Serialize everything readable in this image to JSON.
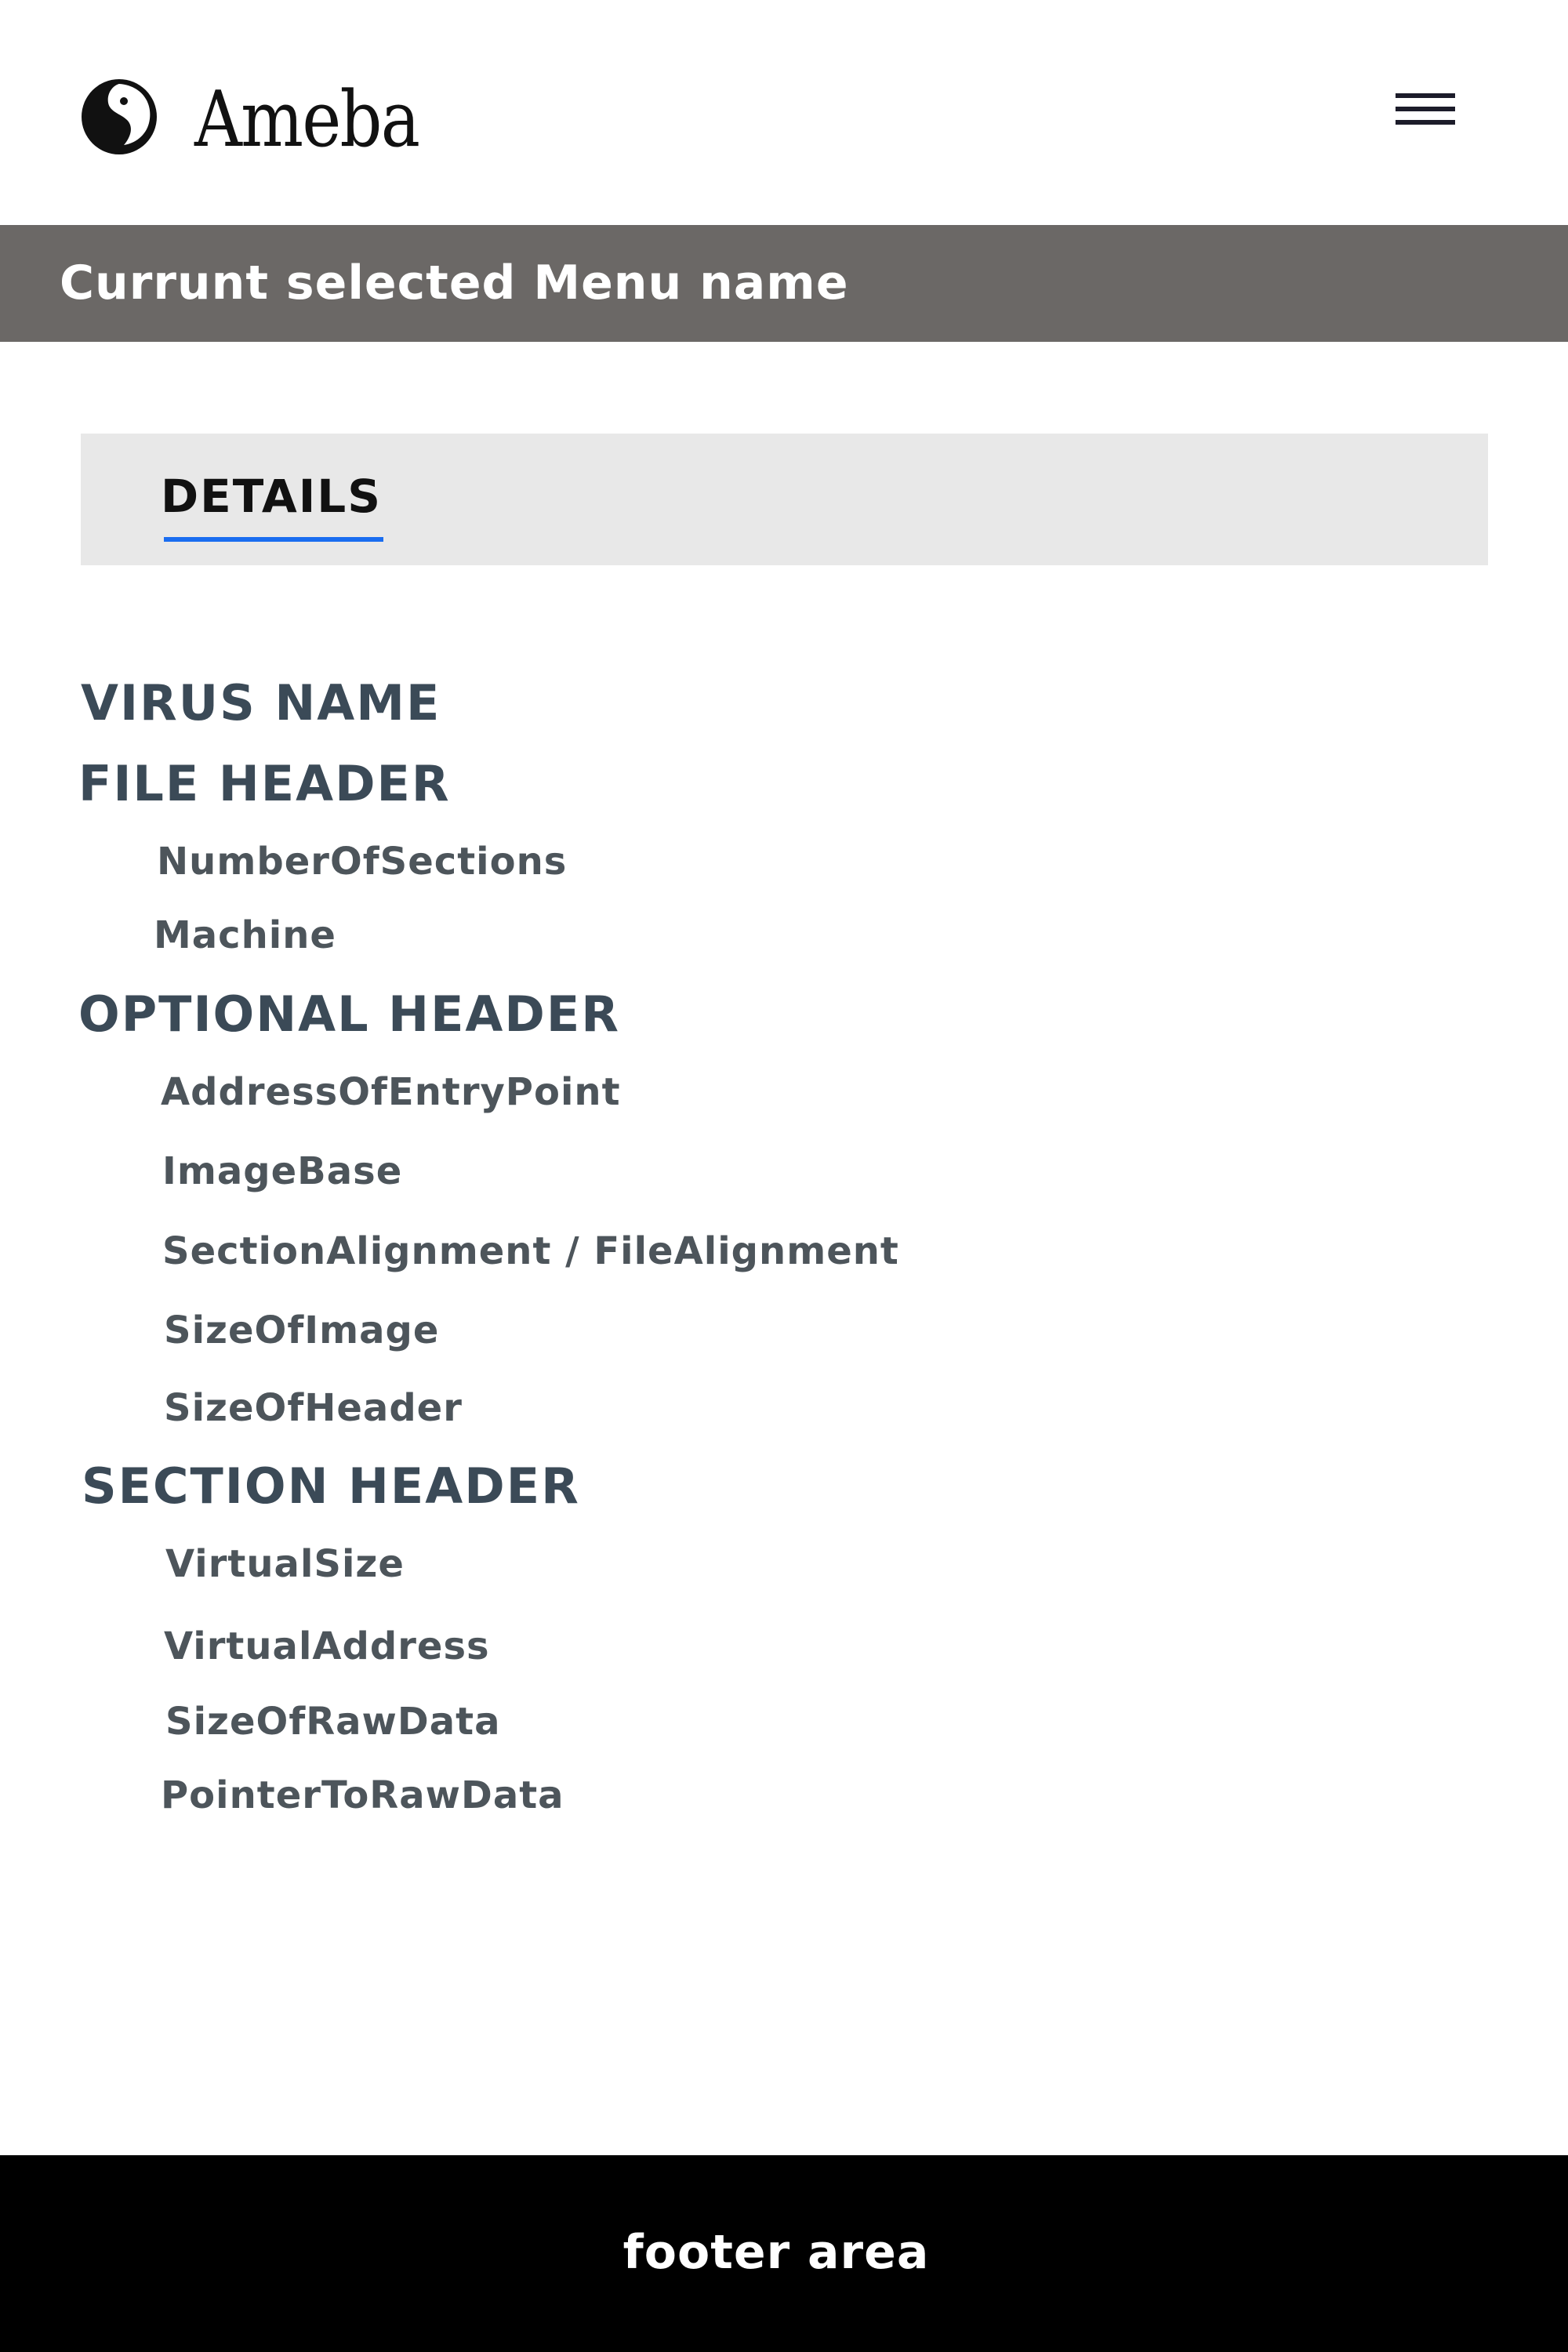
{
  "header": {
    "logo_text": "Ameba",
    "logo_icon": "ameba-logo-icon",
    "menu_icon": "hamburger-menu-icon"
  },
  "selected_menu": {
    "title": "Currunt selected Menu name"
  },
  "tabs": [
    {
      "label": "DETAILS",
      "active": true
    }
  ],
  "details": {
    "virus_name": {
      "title": "VIRUS NAME"
    },
    "file_header": {
      "title": "FILE HEADER",
      "fields": [
        "NumberOfSections",
        "Machine"
      ]
    },
    "optional_header": {
      "title": "OPTIONAL HEADER",
      "fields": [
        "AddressOfEntryPoint",
        "ImageBase",
        "SectionAlignment / FileAlignment",
        "SizeOfImage",
        "SizeOfHeader"
      ]
    },
    "section_header": {
      "title": "SECTION HEADER",
      "fields": [
        "VirtualSize",
        "VirtualAddress",
        "SizeOfRawData",
        "PointerToRawData"
      ]
    }
  },
  "footer": {
    "text": "footer area"
  },
  "colors": {
    "selected_menu_bar": "#6b6866",
    "tab_bar": "#e8e8e8",
    "tab_underline": "#1a6df0",
    "section_title": "#3b4a57",
    "field_text": "#4d555b",
    "footer_bg": "#000000"
  }
}
